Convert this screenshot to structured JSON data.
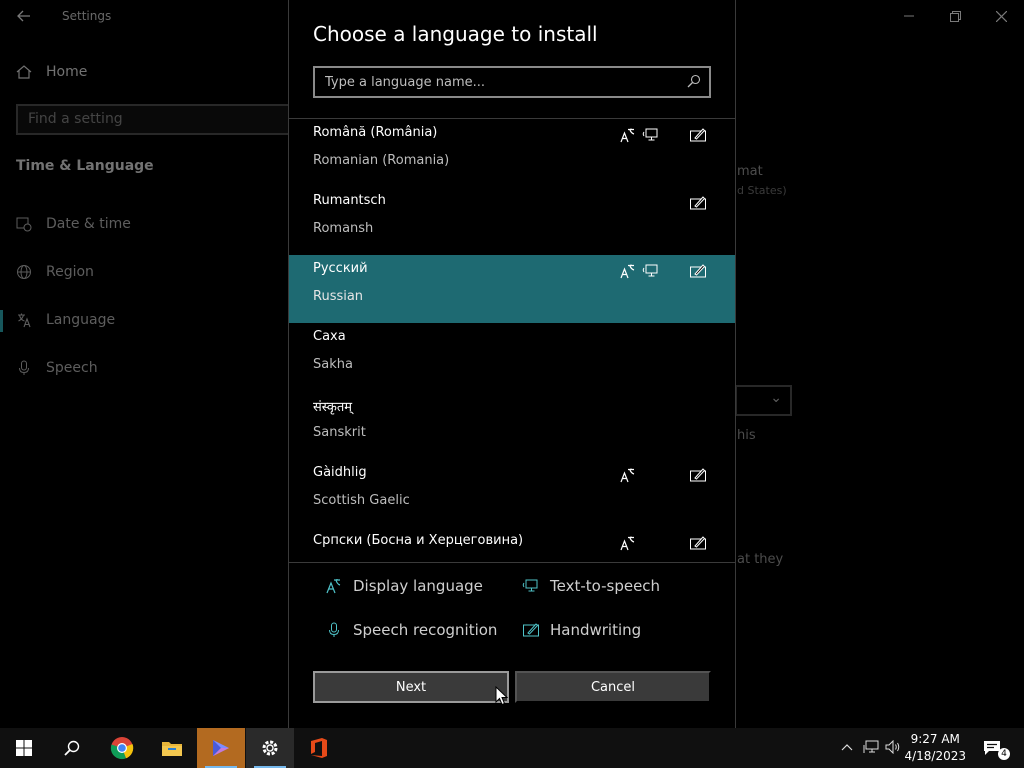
{
  "settings": {
    "app_title": "Settings",
    "home_label": "Home",
    "search_placeholder": "Find a setting",
    "section_title": "Time & Language",
    "nav_items": [
      {
        "label": "Date & time",
        "icon": "calendar-clock-icon"
      },
      {
        "label": "Region",
        "icon": "globe-icon"
      },
      {
        "label": "Language",
        "icon": "language-icon",
        "active": true
      },
      {
        "label": "Speech",
        "icon": "microphone-icon"
      }
    ],
    "partial_right_text": [
      "mat",
      "d States)",
      "his",
      "at they"
    ]
  },
  "dialog": {
    "title": "Choose a language to install",
    "search_placeholder": "Type a language name...",
    "languages": [
      {
        "native": "Română (România)",
        "english": "Romanian (Romania)",
        "display": true,
        "tts": true,
        "handwriting": true,
        "selected": false
      },
      {
        "native": "Rumantsch",
        "english": "Romansh",
        "display": false,
        "tts": false,
        "handwriting": true,
        "selected": false
      },
      {
        "native": "Русский",
        "english": "Russian",
        "display": true,
        "tts": true,
        "handwriting": true,
        "selected": true
      },
      {
        "native": "Саха",
        "english": "Sakha",
        "display": false,
        "tts": false,
        "handwriting": false,
        "selected": false
      },
      {
        "native": "संस्कृतम्",
        "english": "Sanskrit",
        "display": false,
        "tts": false,
        "handwriting": false,
        "selected": false
      },
      {
        "native": "Gàidhlig",
        "english": "Scottish Gaelic",
        "display": true,
        "tts": false,
        "handwriting": true,
        "selected": false
      },
      {
        "native": "Српски (Босна и Херцеговина)",
        "english": "",
        "display": true,
        "tts": false,
        "handwriting": true,
        "selected": false
      }
    ],
    "legend": {
      "display_language": "Display language",
      "text_to_speech": "Text-to-speech",
      "speech_recognition": "Speech recognition",
      "handwriting": "Handwriting"
    },
    "next_label": "Next",
    "cancel_label": "Cancel"
  },
  "taskbar": {
    "apps": [
      "windows-start",
      "search",
      "chrome",
      "file-explorer",
      "photo-app",
      "settings",
      "office"
    ],
    "time": "9:27 AM",
    "date": "4/18/2023",
    "notification_count": "4"
  },
  "colors": {
    "accent": "#2a9fa8",
    "selected_row": "#1e6a72",
    "icon_accent": "#4fc3c9"
  }
}
